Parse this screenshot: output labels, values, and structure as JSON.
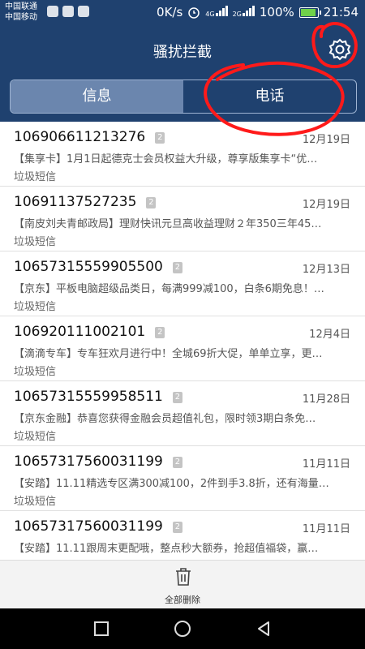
{
  "status": {
    "carrier1": "中国联通",
    "carrier2": "中国移动",
    "speed": "0K/s",
    "net1": "4G",
    "net2": "2G",
    "battery": "100%",
    "battery_level": 1.0,
    "time": "21:54"
  },
  "header": {
    "title": "骚扰拦截",
    "settings_icon": "gear-icon"
  },
  "tabs": [
    {
      "label": "信息",
      "active": true
    },
    {
      "label": "电话",
      "active": false
    }
  ],
  "messages": [
    {
      "number": "106906611213276",
      "count": "2",
      "date": "12月19日",
      "preview": "【集享卡】1月1日起德克士会员权益大升级，尊享版集享卡“优…",
      "kind": "垃圾短信"
    },
    {
      "number": "10691137527235",
      "count": "2",
      "date": "12月19日",
      "preview": "【南皮刘夫青邮政局】理财快讯元旦高收益理财２年350三年45…",
      "kind": "垃圾短信"
    },
    {
      "number": "10657315559905500",
      "count": "2",
      "date": "12月13日",
      "preview": "【京东】平板电脑超级品类日，每满999减100，白条6期免息！…",
      "kind": "垃圾短信"
    },
    {
      "number": "106920111002101",
      "count": "2",
      "date": "12月4日",
      "preview": "【滴滴专车】专车狂欢月进行中！全城69折大促，单单立享，更…",
      "kind": "垃圾短信"
    },
    {
      "number": "10657315559958511",
      "count": "2",
      "date": "11月28日",
      "preview": "【京东金融】恭喜您获得金融会员超值礼包，限时领3期白条免…",
      "kind": "垃圾短信"
    },
    {
      "number": "10657317560031199",
      "count": "2",
      "date": "11月11日",
      "preview": "【安踏】11.11精选专区满300减100，2件到手3.8折，还有海量…",
      "kind": "垃圾短信"
    },
    {
      "number": "10657317560031199",
      "count": "2",
      "date": "11月11日",
      "preview": "【安踏】11.11跟周末更配哦，整点秒大额券，抢超值福袋，赢…",
      "kind": "垃圾短信"
    }
  ],
  "bottom": {
    "delete_all": "全部删除",
    "icon": "trash-icon"
  },
  "colors": {
    "header": "#1f416f",
    "tab_active": "#6b86ae",
    "annotation": "#ff1a1a"
  }
}
